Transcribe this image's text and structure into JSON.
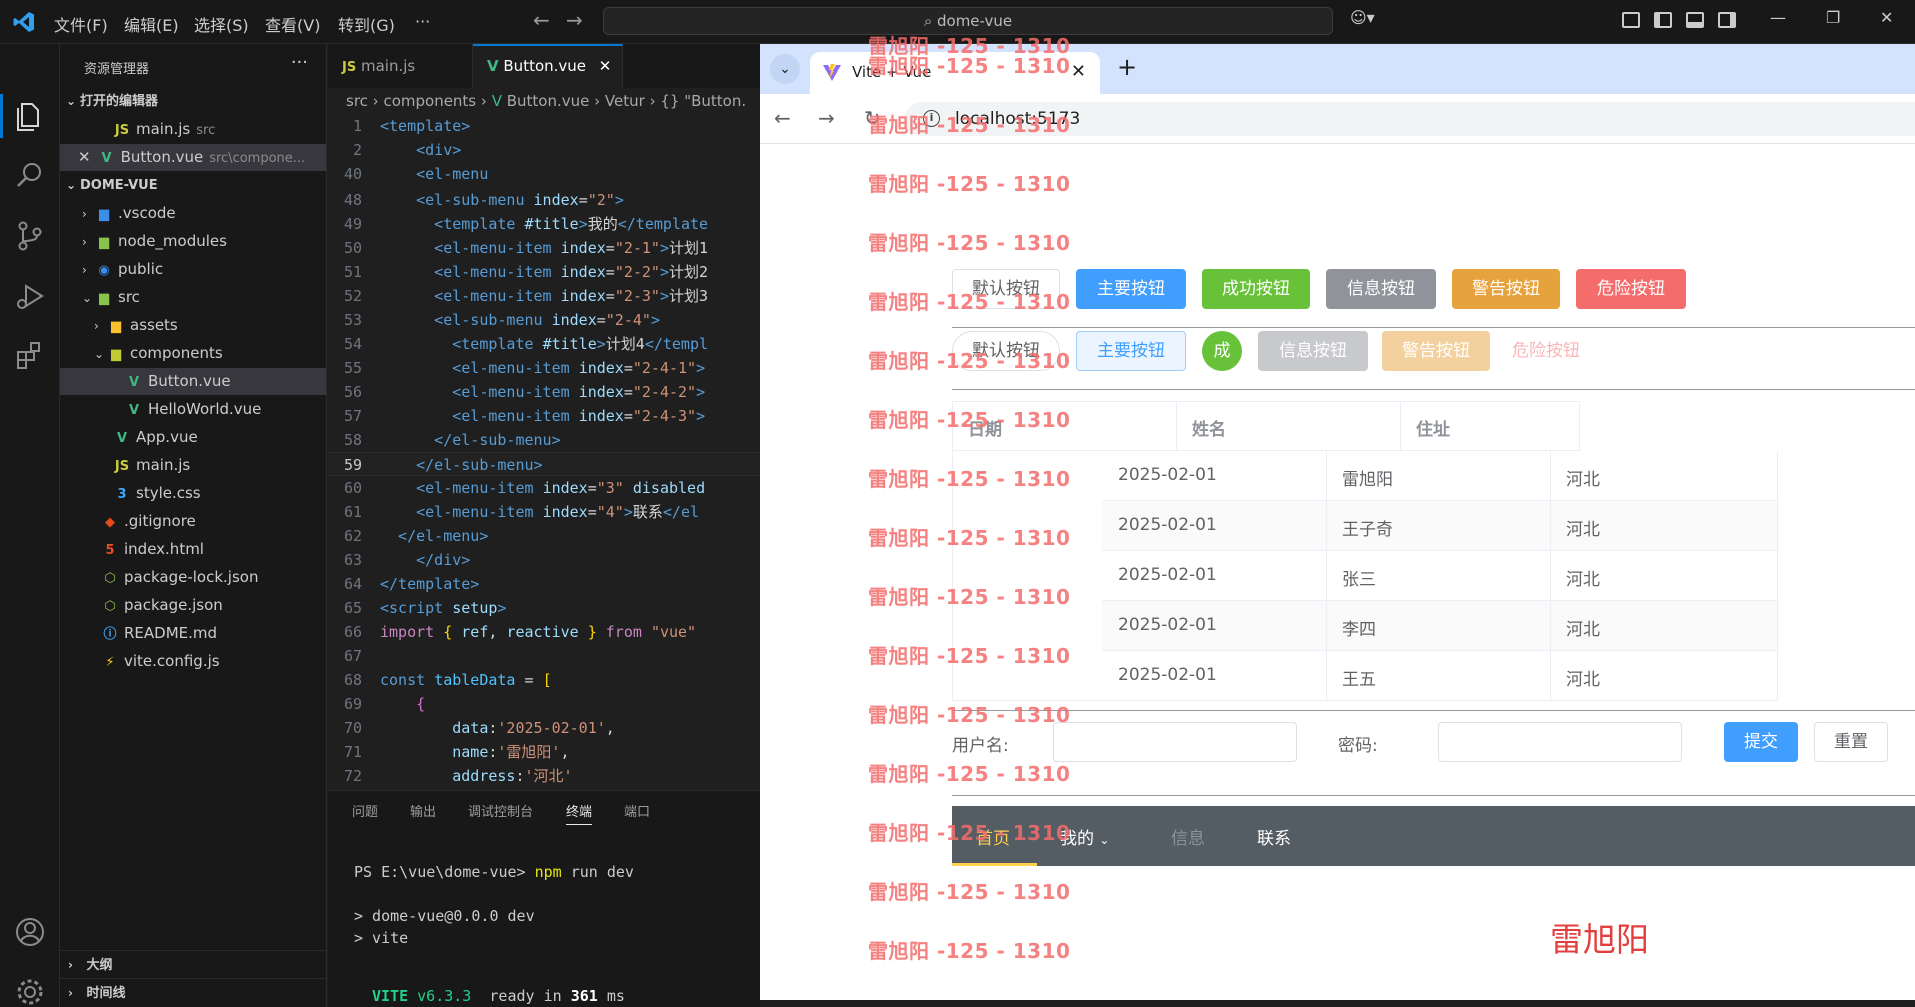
{
  "titlebar": {
    "menu": [
      "文件(F)",
      "编辑(E)",
      "选择(S)",
      "查看(V)",
      "转到(G)"
    ],
    "more": "···",
    "search": "dome-vue"
  },
  "explorer": {
    "header": "资源管理器",
    "more": "···",
    "open_editors": "打开的编辑器",
    "open_files": [
      {
        "name": "main.js",
        "path": "src"
      },
      {
        "name": "Button.vue",
        "path": "src\\compone..."
      }
    ],
    "project": "DOME-VUE",
    "tree": [
      ".vscode",
      "node_modules",
      "public",
      "src",
      "assets",
      "components",
      "Button.vue",
      "HelloWorld.vue",
      "App.vue",
      "main.js",
      "style.css",
      ".gitignore",
      "index.html",
      "package-lock.json",
      "package.json",
      "README.md",
      "vite.config.js"
    ],
    "outline": "大纲",
    "timeline": "时间线"
  },
  "editor": {
    "tabs": [
      "main.js",
      "Button.vue"
    ],
    "close": "✕",
    "breadcrumb": [
      "src",
      "components",
      "Button.vue",
      "Vetur",
      "{} \"Button."
    ],
    "line_numbers": [
      "1",
      "2",
      "40",
      "48",
      "49",
      "50",
      "51",
      "52",
      "53",
      "54",
      "55",
      "56",
      "57",
      "58",
      "59",
      "60",
      "61",
      "62",
      "63",
      "64",
      "65",
      "66",
      "67",
      "68",
      "69",
      "70",
      "71",
      "72"
    ]
  },
  "panel": {
    "tabs": [
      "问题",
      "输出",
      "调试控制台",
      "终端",
      "端口"
    ],
    "prompt": "PS E:\\vue\\dome-vue>",
    "command": "npm",
    "command_args": "run dev",
    "out1": "> dome-vue@0.0.0 dev",
    "out2": "> vite",
    "vite": "VITE",
    "vite_version": "v6.3.3",
    "ready_text": "ready in",
    "ready_ms": "361",
    "ms": "ms"
  },
  "browser": {
    "tab_title": "Vite + Vue",
    "close": "✕",
    "new_tab": "+",
    "url": "localhost:5173"
  },
  "page": {
    "buttons_row1": [
      "默认按钮",
      "主要按钮",
      "成功按钮",
      "信息按钮",
      "警告按钮",
      "危险按钮"
    ],
    "buttons_row2": [
      "默认按钮",
      "主要按钮",
      "成",
      "信息按钮",
      "警告按钮",
      "危险按钮"
    ],
    "table": {
      "headers": [
        "日期",
        "姓名",
        "住址"
      ],
      "rows": [
        {
          "date": "2025-02-01",
          "name": "雷旭阳",
          "address": "河北"
        },
        {
          "date": "2025-02-01",
          "name": "王子奇",
          "address": "河北"
        },
        {
          "date": "2025-02-01",
          "name": "张三",
          "address": "河北"
        },
        {
          "date": "2025-02-01",
          "name": "李四",
          "address": "河北"
        },
        {
          "date": "2025-02-01",
          "name": "王五",
          "address": "河北"
        }
      ]
    },
    "form": {
      "username_label": "用户名:",
      "password_label": "密码:",
      "submit": "提交",
      "reset": "重置"
    },
    "menu": {
      "home": "首页",
      "mine": "我的",
      "info": "信息",
      "contact": "联系"
    },
    "watermark": "雷旭阳 -125 - 1310",
    "footer_name": "雷旭阳"
  }
}
